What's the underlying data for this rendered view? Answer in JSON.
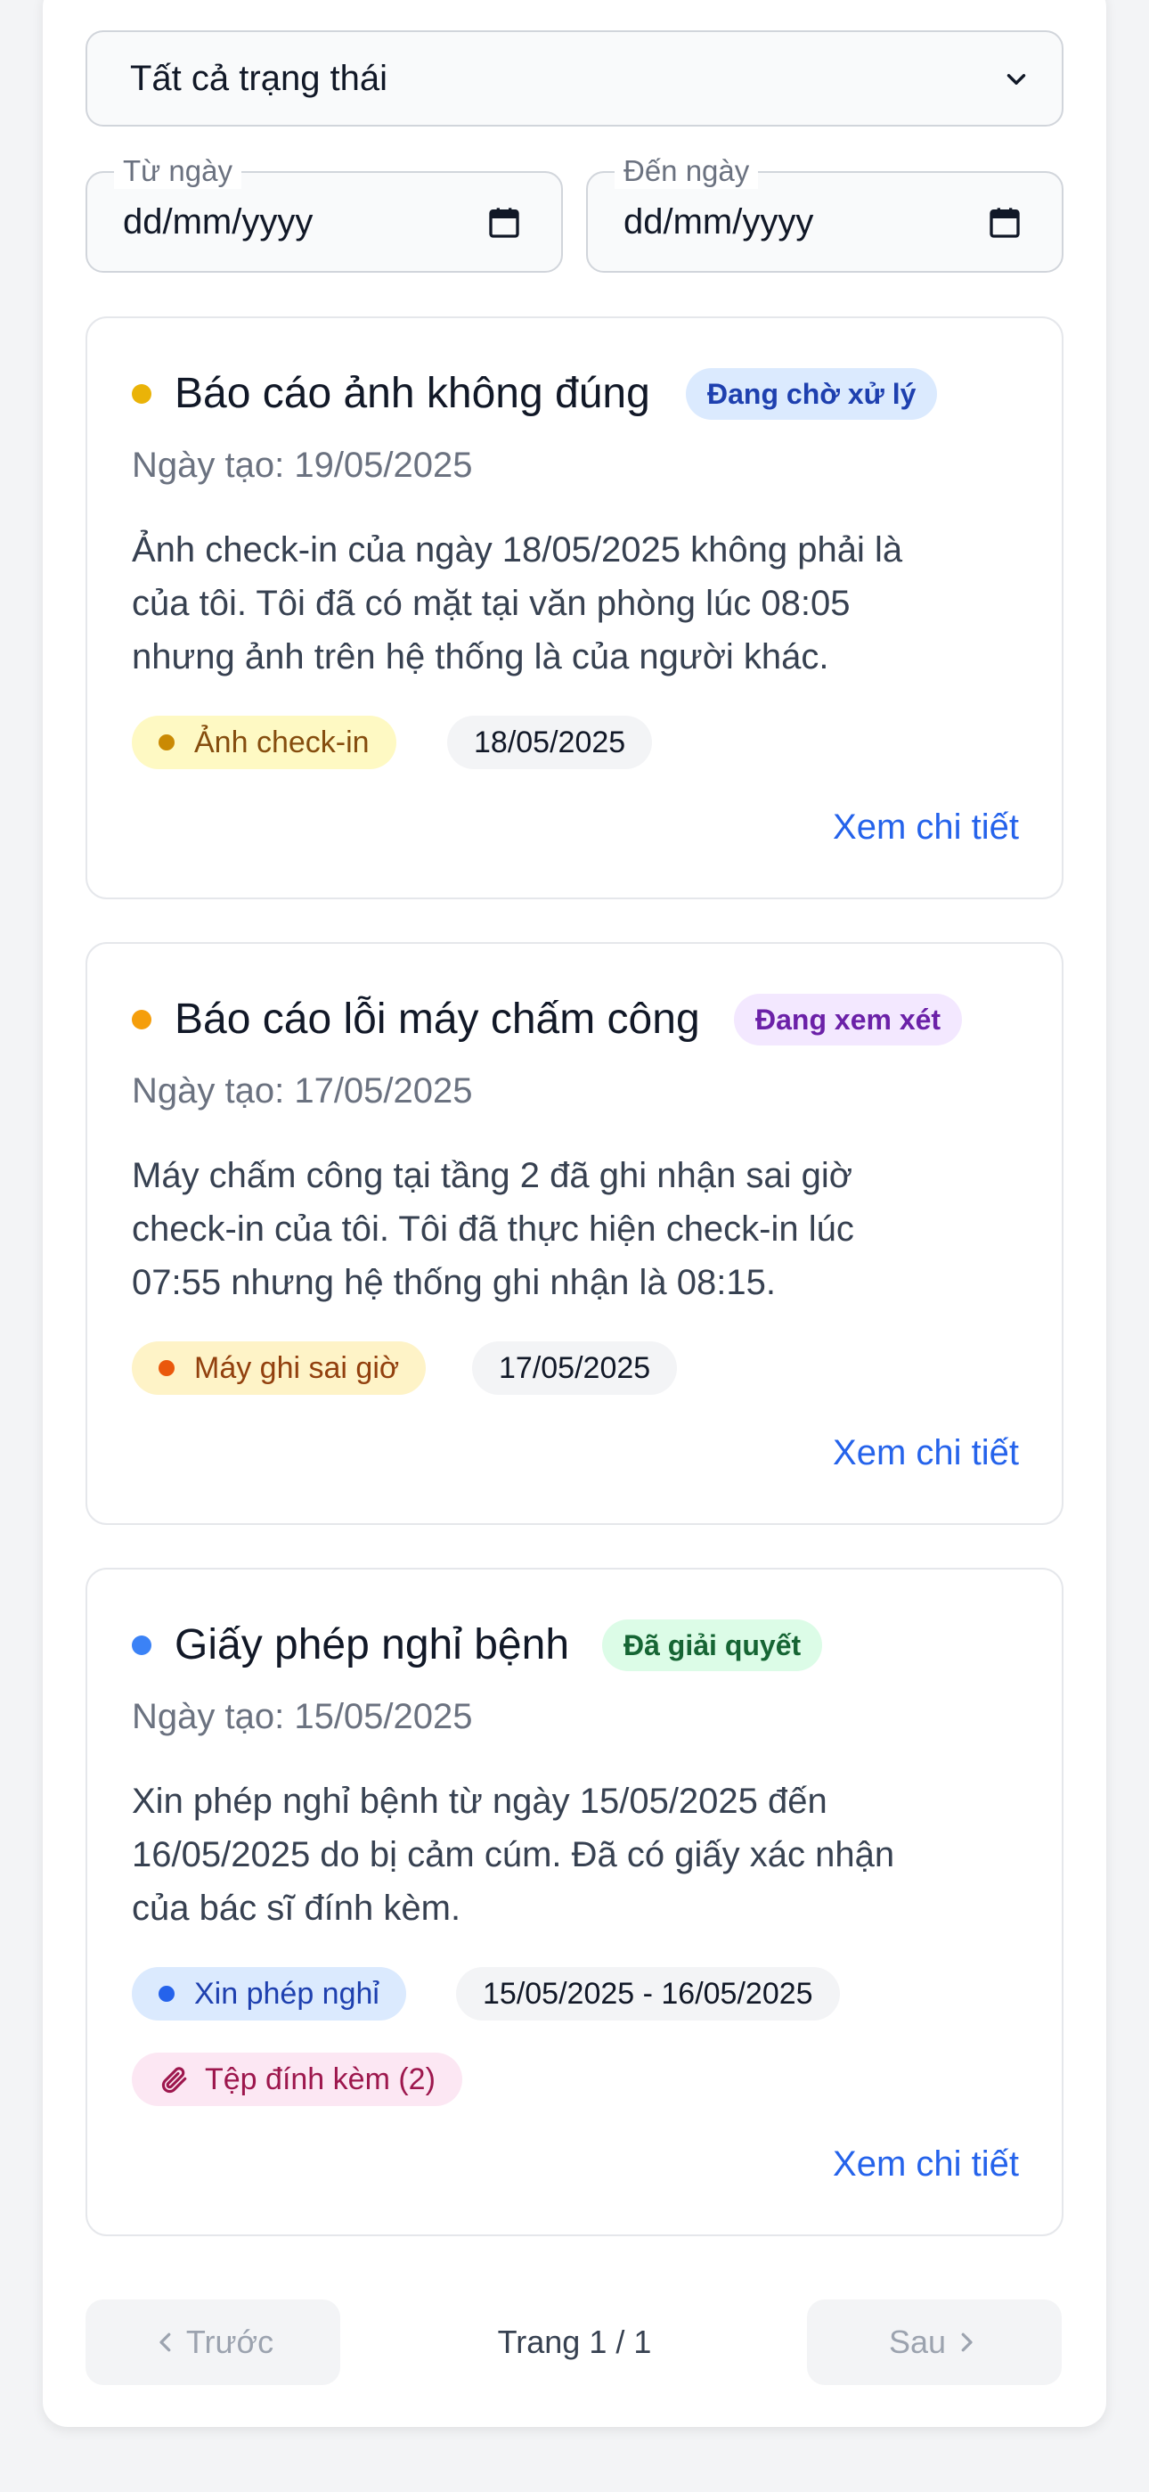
{
  "filters": {
    "status_select": "Tất cả trạng thái",
    "from_date": {
      "label": "Từ ngày",
      "value": "dd/mm/yyyy"
    },
    "to_date": {
      "label": "Đến ngày",
      "value": "dd/mm/yyyy"
    }
  },
  "reports": [
    {
      "title": "Báo cáo ảnh không đúng",
      "dot_color": "#eab308",
      "status": {
        "label": "Đang chờ xử lý",
        "bg": "#dbeafe",
        "color": "#1e40af"
      },
      "created": "Ngày tạo: 19/05/2025",
      "description_lines": [
        "Ảnh check-in của ngày 18/05/2025 không phải là",
        "của tôi. Tôi đã có mặt tại văn phòng lúc 08:05",
        "nhưng ảnh trên hệ thống là của người khác."
      ],
      "type_tag": {
        "label": "Ảnh check-in",
        "bg": "#fef9c3",
        "color": "#854d0e",
        "dot": "#ca8a04"
      },
      "date_tag": "18/05/2025",
      "link": "Xem chi tiết"
    },
    {
      "title": "Báo cáo lỗi máy chấm công",
      "dot_color": "#f59e0b",
      "status": {
        "label": "Đang xem xét",
        "bg": "#f3e8ff",
        "color": "#6b21a8"
      },
      "created": "Ngày tạo: 17/05/2025",
      "description_lines": [
        "Máy chấm công tại tầng 2 đã ghi nhận sai giờ",
        "check-in của tôi. Tôi đã thực hiện check-in lúc",
        "07:55 nhưng hệ thống ghi nhận là 08:15."
      ],
      "type_tag": {
        "label": "Máy ghi sai giờ",
        "bg": "#fef3c7",
        "color": "#92400e",
        "dot": "#ea580c"
      },
      "date_tag": "17/05/2025",
      "link": "Xem chi tiết"
    },
    {
      "title": "Giấy phép nghỉ bệnh",
      "dot_color": "#3b82f6",
      "status": {
        "label": "Đã giải quyết",
        "bg": "#dcfce7",
        "color": "#166534"
      },
      "created": "Ngày tạo: 15/05/2025",
      "description_lines": [
        "Xin phép nghỉ bệnh từ ngày 15/05/2025 đến",
        "16/05/2025 do bị cảm cúm. Đã có giấy xác nhận",
        "của bác sĩ đính kèm."
      ],
      "type_tag": {
        "label": "Xin phép nghỉ",
        "bg": "#dbeafe",
        "color": "#1e40af",
        "dot": "#2563eb"
      },
      "date_tag": "15/05/2025 - 16/05/2025",
      "attachment_tag": {
        "label": "Tệp đính kèm (2)",
        "bg": "#fce7f3",
        "color": "#9d174d"
      },
      "link": "Xem chi tiết"
    }
  ],
  "pagination": {
    "prev": "Trước",
    "page_info": "Trang 1 / 1",
    "next": "Sau"
  }
}
